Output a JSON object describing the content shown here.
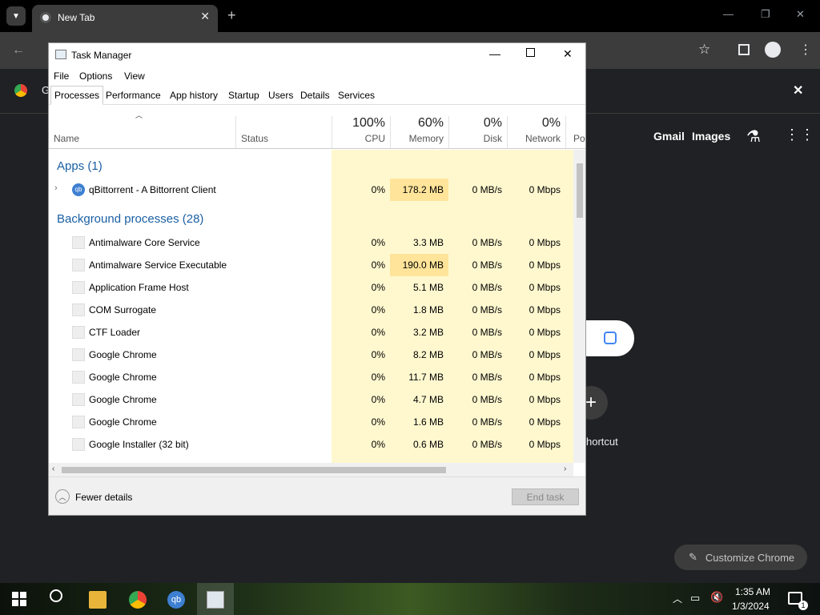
{
  "chrome": {
    "tab_title": "New Tab",
    "new_tab": "+",
    "gmail": "Gmail",
    "images": "Images",
    "add_shortcut": "+",
    "shortcut_label": "hortcut",
    "customize": "Customize Chrome",
    "bookmark_initial": "G"
  },
  "task_manager": {
    "title": "Task Manager",
    "menu": [
      "File",
      "Options",
      "View"
    ],
    "tabs": [
      "Processes",
      "Performance",
      "App history",
      "Startup",
      "Users",
      "Details",
      "Services"
    ],
    "columns": {
      "name": "Name",
      "status": "Status",
      "cpu_pct": "100%",
      "cpu": "CPU",
      "memory_pct": "60%",
      "memory": "Memory",
      "disk_pct": "0%",
      "disk": "Disk",
      "network_pct": "0%",
      "network": "Network",
      "power": "Po"
    },
    "groups": {
      "apps": "Apps (1)",
      "background": "Background processes (28)"
    },
    "apps": [
      {
        "name": "qBittorrent - A Bittorrent Client",
        "cpu": "0%",
        "memory": "178.2 MB",
        "disk": "0 MB/s",
        "network": "0 Mbps"
      }
    ],
    "background": [
      {
        "name": "Antimalware Core Service",
        "cpu": "0%",
        "memory": "3.3 MB",
        "disk": "0 MB/s",
        "network": "0 Mbps"
      },
      {
        "name": "Antimalware Service Executable",
        "cpu": "0%",
        "memory": "190.0 MB",
        "disk": "0 MB/s",
        "network": "0 Mbps"
      },
      {
        "name": "Application Frame Host",
        "cpu": "0%",
        "memory": "5.1 MB",
        "disk": "0 MB/s",
        "network": "0 Mbps"
      },
      {
        "name": "COM Surrogate",
        "cpu": "0%",
        "memory": "1.8 MB",
        "disk": "0 MB/s",
        "network": "0 Mbps"
      },
      {
        "name": "CTF Loader",
        "cpu": "0%",
        "memory": "3.2 MB",
        "disk": "0 MB/s",
        "network": "0 Mbps"
      },
      {
        "name": "Google Chrome",
        "cpu": "0%",
        "memory": "8.2 MB",
        "disk": "0 MB/s",
        "network": "0 Mbps"
      },
      {
        "name": "Google Chrome",
        "cpu": "0%",
        "memory": "11.7 MB",
        "disk": "0 MB/s",
        "network": "0 Mbps"
      },
      {
        "name": "Google Chrome",
        "cpu": "0%",
        "memory": "4.7 MB",
        "disk": "0 MB/s",
        "network": "0 Mbps"
      },
      {
        "name": "Google Chrome",
        "cpu": "0%",
        "memory": "1.6 MB",
        "disk": "0 MB/s",
        "network": "0 Mbps"
      },
      {
        "name": "Google Installer (32 bit)",
        "cpu": "0%",
        "memory": "0.6 MB",
        "disk": "0 MB/s",
        "network": "0 Mbps"
      }
    ],
    "fewer_details": "Fewer details",
    "end_task": "End task"
  },
  "taskbar": {
    "time": "1:35 AM",
    "date": "1/3/2024",
    "notification_count": "1",
    "icons": [
      "windows-start-icon",
      "search-icon",
      "file-explorer-icon",
      "chrome-icon",
      "qbittorrent-icon",
      "task-manager-icon"
    ]
  },
  "colors": {
    "heat_light": "#fff8cf",
    "heat_strong": "#ffe49a",
    "group_blue": "#1a5fa3"
  }
}
